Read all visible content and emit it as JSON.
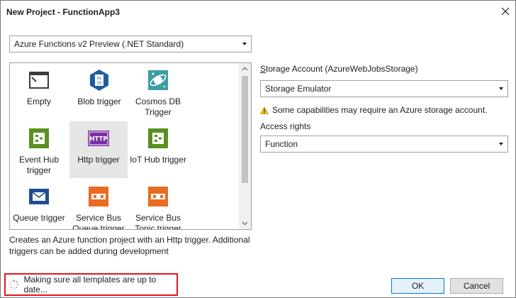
{
  "window": {
    "title": "New Project - FunctionApp3"
  },
  "version_select": {
    "value": "Azure Functions v2 Preview (.NET Standard)"
  },
  "templates": [
    {
      "name": "empty",
      "label": "Empty"
    },
    {
      "name": "blob-trigger",
      "label": "Blob trigger"
    },
    {
      "name": "cosmos-db-trigger",
      "label": "Cosmos DB Trigger"
    },
    {
      "name": "event-hub-trigger",
      "label": "Event Hub trigger"
    },
    {
      "name": "http-trigger",
      "label": "Http trigger",
      "selected": true
    },
    {
      "name": "iot-hub-trigger",
      "label": "IoT Hub trigger"
    },
    {
      "name": "queue-trigger",
      "label": "Queue trigger"
    },
    {
      "name": "service-bus-queue-trigger",
      "label": "Service Bus Queue trigger"
    },
    {
      "name": "service-bus-topic-trigger",
      "label": "Service Bus Topic trigger"
    }
  ],
  "http_icon_text": "HTTP",
  "blob_icon_text": "01\n10",
  "description": "Creates an Azure function project with an Http trigger.  Additional triggers can be added during development",
  "storage": {
    "label_accel": "S",
    "label_rest": "torage Account (AzureWebJobsStorage)",
    "value": "Storage Emulator",
    "warning": "Some capabilities may require an Azure storage account."
  },
  "access": {
    "label": "Access rights",
    "value": "Function"
  },
  "status": {
    "text": "Making sure all templates are up to date..."
  },
  "buttons": {
    "ok": "OK",
    "cancel": "Cancel"
  },
  "colors": {
    "highlight": "#e8141c",
    "accent": "#0078d7"
  }
}
